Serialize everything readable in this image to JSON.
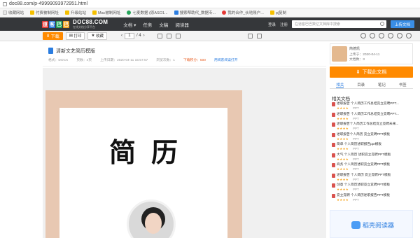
{
  "browser": {
    "url": "doc88.com/p-49999093972951.html",
    "bookmarks": [
      "收藏网站",
      "付费被制网址",
      "升级站站",
      "Mac被制网址",
      "七麦数据 (原ASO1...",
      "搜索帮助代_数据专...",
      "我的合作_伙哒账户...",
      "pj复制"
    ]
  },
  "site": {
    "logo_chars": [
      "道",
      "客",
      "巴",
      "巴"
    ],
    "logo_domain": "DOC88.COM",
    "logo_tagline": "在线文档分享平台",
    "nav": [
      "文档 ▾",
      "任务",
      "文稿",
      "阅读器"
    ],
    "login": "登录",
    "register": "注册",
    "search_placeholder": "在道客巴巴数亿文档库中搜索",
    "upload": "上传文档"
  },
  "toolbar": {
    "download": "下载",
    "print": "打印",
    "favorite": "收藏",
    "page_current": "1",
    "page_total": "/ 4"
  },
  "doc": {
    "title": "清新文艺简历模版",
    "format": "格式：DOCX",
    "pages": "页数：4页",
    "uploaded": "上传日期：2020-04-11 15:57:57",
    "views": "浏览次数：1",
    "points": "下载积分：500",
    "add_app": "用阅客阅读打开",
    "page_title": "简历"
  },
  "sidebar": {
    "author_name": "简德凯",
    "author_date": "上传于：2020-04-11",
    "author_count": "文档数：3",
    "download": "下载此文档",
    "tabs": [
      "相关",
      "目录",
      "笔记",
      "书签"
    ],
    "related_title": "相关文档",
    "related": [
      {
        "title": "述职报告 个人简历工作总结竞立竞聘PPT...",
        "stars": "★★★★",
        "format": "PPT"
      },
      {
        "title": "述职报告 个人简历工作总结竞立竞聘PPT...",
        "stars": "★★★★",
        "format": "PPT"
      },
      {
        "title": "述职报告个人简历工作总结竞立竞聘未来...",
        "stars": "★★★★",
        "format": "PPT"
      },
      {
        "title": "述职报告个人简历 竞立竞聘PPT模板",
        "stars": "★★★★",
        "format": "PPT"
      },
      {
        "title": "简单 个人简历述职报告ppt模板",
        "stars": "★★★★",
        "format": "PPT"
      },
      {
        "title": "大气 个人简历 述职竞立竞聘PPT模板",
        "stars": "★★★★",
        "format": "PPT"
      },
      {
        "title": "商务 个人简历述职竞立竞聘PPT模板",
        "stars": "★★★★",
        "format": "PPT"
      },
      {
        "title": "述职报告 个人简历 竞立竞聘PPT模板",
        "stars": "★★★★",
        "format": "PPT"
      },
      {
        "title": "创意 个人简历述职竞立竞聘PPT模板",
        "stars": "★★★★",
        "format": "PPT"
      },
      {
        "title": "竞立竞聘 个人简历述职报告PPT模板",
        "stars": "★★★★",
        "format": "PPT"
      }
    ],
    "ad_text": "稻壳阅读器"
  },
  "colors": {
    "header_bg": "#35373a",
    "accent_orange": "#ff8a00",
    "accent_blue": "#2b7de0",
    "page_border": "#e8c8b2"
  }
}
